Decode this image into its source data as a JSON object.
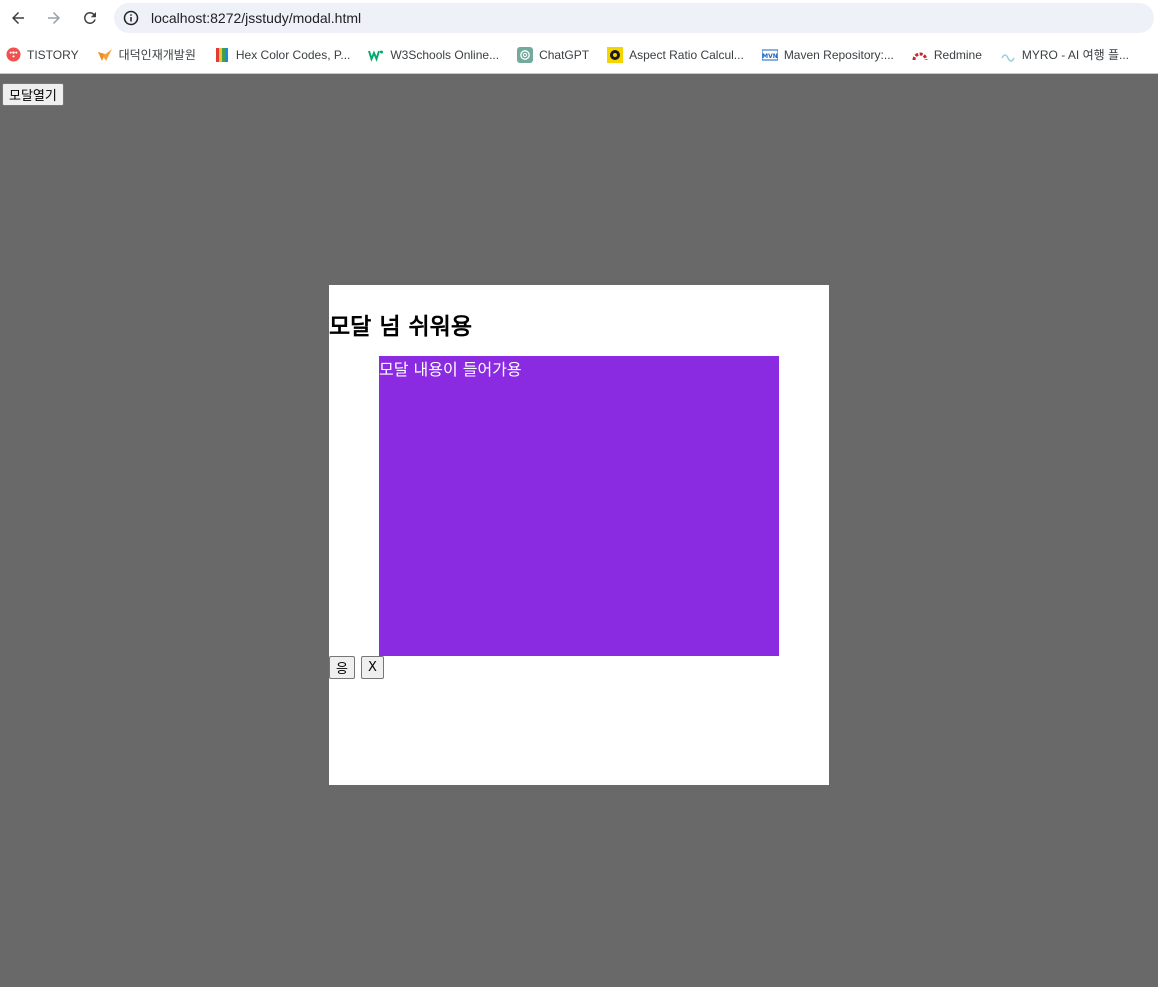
{
  "browser": {
    "url": "localhost:8272/jsstudy/modal.html",
    "bookmarks": [
      {
        "label": "TISTORY",
        "icon": "tistory-icon",
        "color": "#ef5350"
      },
      {
        "label": "대덕인재개발원",
        "icon": "ddit-icon",
        "color": "#f28c28"
      },
      {
        "label": "Hex Color Codes, P...",
        "icon": "color-book-icon",
        "color": "#3f51b5"
      },
      {
        "label": "W3Schools Online...",
        "icon": "w3schools-icon",
        "color": "#04aa6d"
      },
      {
        "label": "ChatGPT",
        "icon": "chatgpt-icon",
        "color": "#74aa9c"
      },
      {
        "label": "Aspect Ratio Calcul...",
        "icon": "aspect-ratio-icon",
        "color": "#f5d400"
      },
      {
        "label": "Maven Repository:...",
        "icon": "maven-icon",
        "color": "#1565c0"
      },
      {
        "label": "Redmine",
        "icon": "redmine-icon",
        "color": "#c62828"
      },
      {
        "label": "MYRO - AI 여행 플...",
        "icon": "myro-icon",
        "color": "#9ad1d4"
      }
    ]
  },
  "page": {
    "open_button": "모달열기",
    "background": "#696969"
  },
  "modal": {
    "title": "모달 넘 쉬워용",
    "body_text": "모달 내용이 들어가용",
    "body_color": "#8a2be2",
    "confirm_button": "응",
    "close_button": "X"
  }
}
